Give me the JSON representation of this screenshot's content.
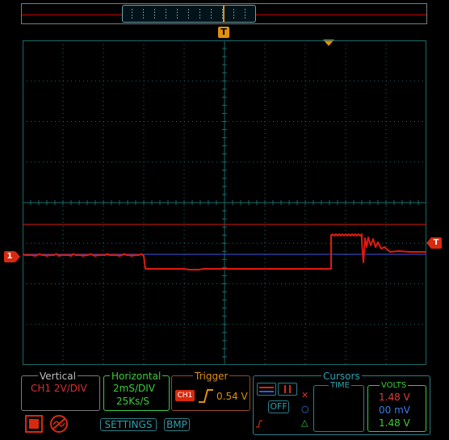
{
  "overview": {
    "trigger_marker_label": "T"
  },
  "markers": {
    "ch1_left_label": "1",
    "ch1_right_label": "T"
  },
  "panels": {
    "vertical": {
      "title": "Vertical",
      "value": "CH1 2V/DIV",
      "color": "#c83030"
    },
    "horizontal": {
      "title": "Horizontal",
      "timebase": "2mS/DIV",
      "sample_rate": "25Ks/S",
      "color": "#3ccb3c"
    },
    "trigger": {
      "title": "Trigger",
      "channel": "CH1",
      "edge_icon": "rising-edge-icon",
      "level": "0.54 V",
      "color": "#e09010"
    },
    "cursors": {
      "title": "Cursors",
      "time_label": "TIME",
      "volts_label": "VOLTS",
      "off_label": "OFF",
      "v1": "1.48 V",
      "dv": "00 mV",
      "v2": "1.48 V",
      "v1_color": "#e03a3a",
      "dv_color": "#3a7ae0",
      "v2_color": "#3ccb3c"
    }
  },
  "buttons": {
    "settings": "SETTINGS",
    "bmp": "BMP"
  },
  "colors": {
    "grid": "#176a6a",
    "ch1": "#e01a10",
    "reference_line": "#3a5ae8",
    "accent_teal": "#2fa0b0"
  }
}
